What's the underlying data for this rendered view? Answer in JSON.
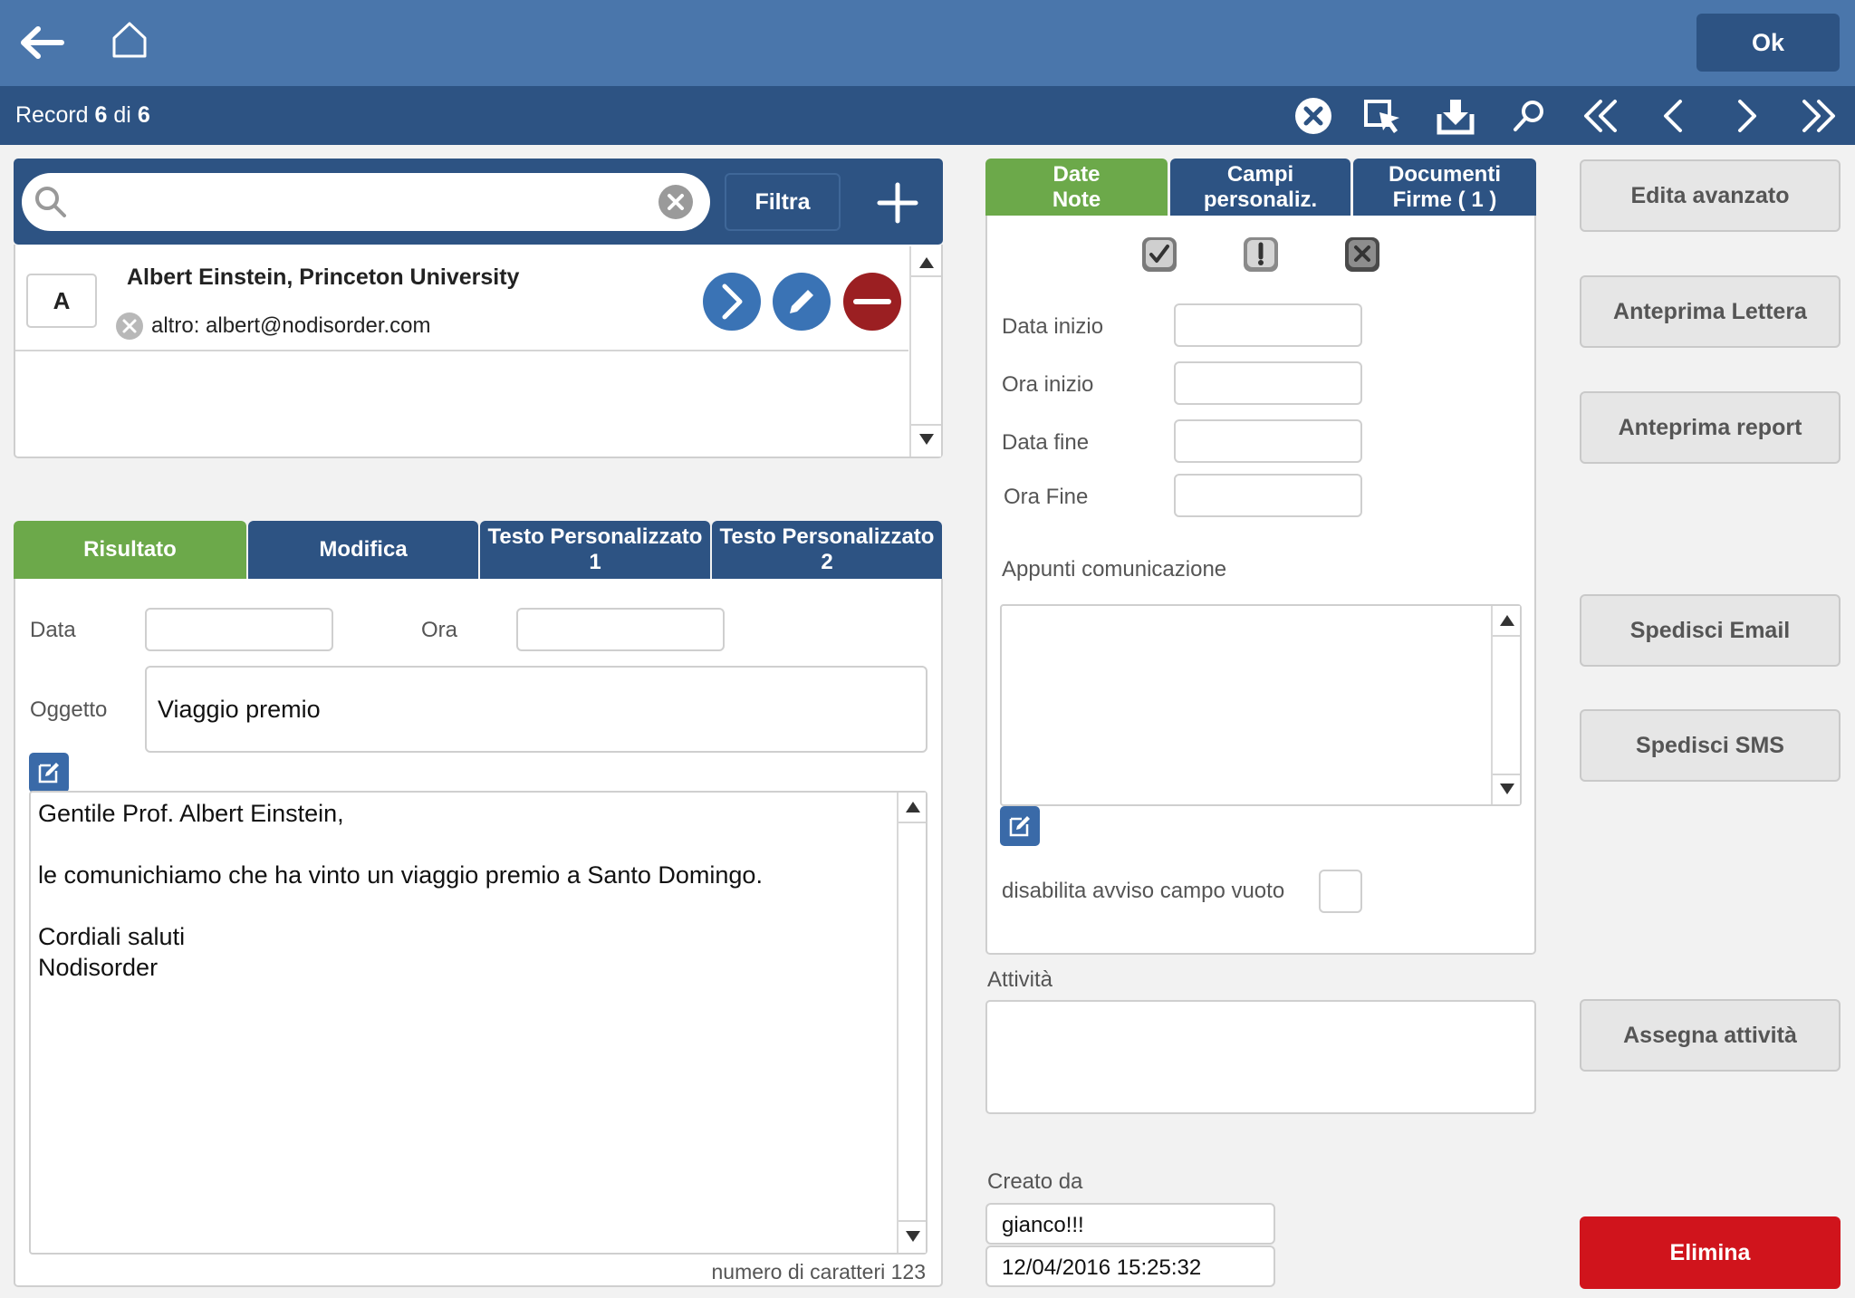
{
  "toolbar": {
    "ok_label": "Ok",
    "back_icon": "arrow-left-icon",
    "home_icon": "home-icon"
  },
  "navbar": {
    "record_prefix": "Record",
    "record_current": "6",
    "record_mid": "di",
    "record_total": "6",
    "icons": [
      "cancel-icon",
      "select-icon",
      "download-icon",
      "search-icon",
      "first-icon",
      "prev-icon",
      "next-icon",
      "last-icon"
    ]
  },
  "search": {
    "placeholder": "",
    "filter_label": "Filtra",
    "add_icon": "plus-icon"
  },
  "contact": {
    "letter": "A",
    "name": "Albert Einstein, Princeton University",
    "email": "altro: albert@nodisorder.com"
  },
  "left_tabs": [
    {
      "label": "Risultato"
    },
    {
      "label": "Modifica"
    },
    {
      "label_line1": "Testo Personalizzato",
      "label_line2": "1"
    },
    {
      "label_line1": "Testo Personalizzato",
      "label_line2": "2"
    }
  ],
  "result_form": {
    "data_label": "Data",
    "data_value": "",
    "ora_label": "Ora",
    "ora_value": "",
    "oggetto_label": "Oggetto",
    "oggetto_value": "Viaggio premio",
    "body_lines": [
      "Gentile Prof. Albert Einstein,",
      "",
      "le comunichiamo che ha vinto un viaggio premio a Santo Domingo.",
      "",
      "Cordiali saluti",
      "Nodisorder"
    ],
    "char_count": "numero di caratteri 123"
  },
  "middle_tabs": [
    {
      "line1": "Date",
      "line2": "Note"
    },
    {
      "line1": "Campi",
      "line2": "personaliz."
    },
    {
      "line1": "Documenti",
      "line2": "Firme ( 1 )"
    }
  ],
  "status_icons": [
    "check-icon",
    "exclamation-icon",
    "x-icon"
  ],
  "dates_form": {
    "data_inizio_label": "Data inizio",
    "ora_inizio_label": "Ora inizio",
    "data_fine_label": "Data fine",
    "ora_fine_label": "Ora Fine",
    "appunti_label": "Appunti comunicazione",
    "disabilita_label": "disabilita avviso campo vuoto"
  },
  "attivita": {
    "label": "Attività",
    "value": ""
  },
  "created": {
    "label": "Creato da",
    "user": "gianco!!!",
    "timestamp": "12/04/2016 15:25:32"
  },
  "right_buttons": {
    "edita": "Edita avanzato",
    "anteprima_lettera": "Anteprima Lettera",
    "anteprima_report": "Anteprima report",
    "spedisci_email": "Spedisci Email",
    "spedisci_sms": "Spedisci SMS",
    "assegna": "Assegna attività",
    "elimina": "Elimina"
  },
  "colors": {
    "topbar": "#4a76ab",
    "navbar": "#2d5383",
    "tab_active": "#6ca94a",
    "delete": "#d0141c"
  }
}
